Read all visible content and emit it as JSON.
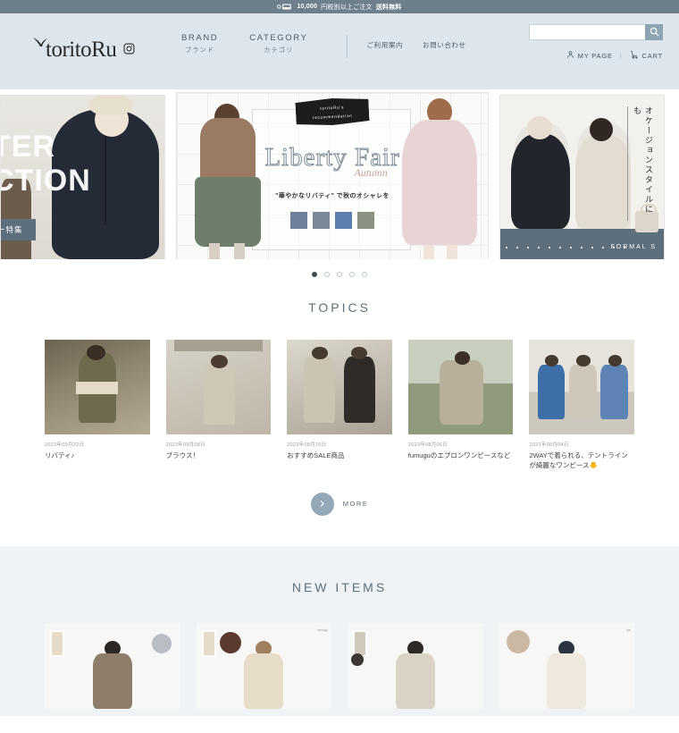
{
  "notice": {
    "icon": "shipping-truck-icon",
    "text_prefix": "10,000",
    "text_mid": "円税別以上ご注文",
    "text_strong": "送料無料"
  },
  "header": {
    "logo_text": "toritoRu",
    "logo_bird_icon": "bird-icon",
    "instagram_icon": "instagram-icon",
    "nav_major": [
      {
        "en": "BRAND",
        "jp": "ブランド"
      },
      {
        "en": "CATEGORY",
        "jp": "カテゴリ"
      }
    ],
    "nav_minor": [
      {
        "label": "ご利用案内"
      },
      {
        "label": "お問い合わせ"
      }
    ],
    "search": {
      "placeholder": "",
      "value": "",
      "button_icon": "search-icon"
    },
    "account": {
      "mypage_label": "MY PAGE",
      "mypage_icon": "person-icon",
      "separator": "|",
      "cart_label": "CART",
      "cart_icon": "cart-icon"
    }
  },
  "hero": {
    "slides": [
      {
        "name": "winter-collection",
        "title_line1": "TER",
        "title_line2": "CTION",
        "button_label": "ー特集"
      },
      {
        "name": "liberty-fair",
        "ribbon_line1": "toritoRu's",
        "ribbon_line2": "recommendation",
        "title": "Liberty Fair",
        "subtitle": "Autumn",
        "caption": "\"華やかなリバティ\" で秋のオシャレを",
        "swatches": [
          "#6f7f9c",
          "#7a8796",
          "#5d7fae",
          "#8a9382"
        ]
      },
      {
        "name": "occasion-style",
        "vertical_text": "オケージョンスタイルにも",
        "footer_label": "FORMAL S"
      }
    ],
    "dots": [
      {
        "active": true
      },
      {
        "active": false
      },
      {
        "active": false
      },
      {
        "active": false
      },
      {
        "active": false
      }
    ]
  },
  "topics": {
    "heading": "TOPICS",
    "items": [
      {
        "date": "2023年09月22日",
        "title": "リバティ♪",
        "tone": "#8f8871"
      },
      {
        "date": "2023年09月08日",
        "title": "ブラウス！",
        "tone": "#c9c2b5"
      },
      {
        "date": "2023年08月15日",
        "title": "おすすめSALE商品",
        "tone": "#b5b0a4"
      },
      {
        "date": "2023年08月06日",
        "title": "fumuguのエプロンワンピースなど",
        "tone": "#9aa68f"
      },
      {
        "date": "2023年08月04日",
        "title": "2WAYで着られる、テントラインが綺麗なワンピース🐥",
        "tone": "#7f93b5"
      }
    ],
    "more_label": "MORE",
    "more_icon": "chevron-right-icon"
  },
  "new_items": {
    "heading": "NEW ITEMS",
    "items": [
      {
        "coat": "#8d7d6a",
        "head": "#2c2722",
        "swatch": "#b9bec4",
        "label": ""
      },
      {
        "coat": "#e7dcc8",
        "head": "#a07f5e",
        "swatch": "#5a3a2e",
        "label": "fumugu"
      },
      {
        "coat": "#d9d3c6",
        "head": "#2f2a25",
        "swatch": "#3c3732",
        "label": ""
      },
      {
        "coat": "#efe8dc",
        "head": "#2b3440",
        "swatch": "#cbb9a4",
        "label": "tyu"
      }
    ]
  },
  "colors": {
    "header_bg": "#dde6ec",
    "notice_bg": "#6e7f8c",
    "accent": "#93a9b8",
    "section_bg": "#eff3f6"
  }
}
